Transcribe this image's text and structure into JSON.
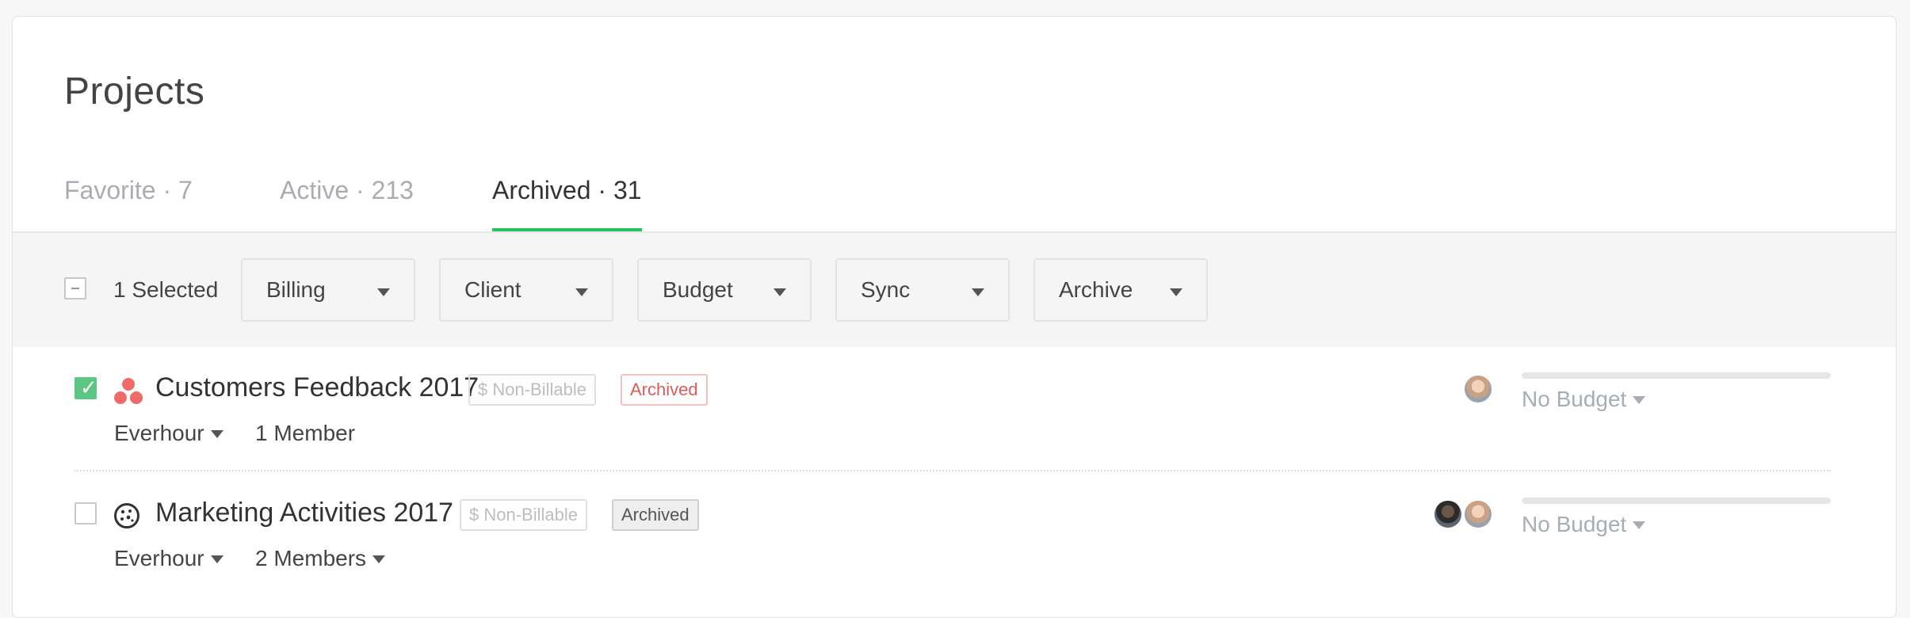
{
  "page": {
    "title": "Projects"
  },
  "tabs": [
    {
      "label": "Favorite · 7",
      "active": false
    },
    {
      "label": "Active · 213",
      "active": false
    },
    {
      "label": "Archived · 31",
      "active": true
    }
  ],
  "toolbar": {
    "selected_label": "1 Selected",
    "dropdowns": [
      "Billing",
      "Client",
      "Budget",
      "Sync",
      "Archive"
    ]
  },
  "projects": [
    {
      "name": "Customers Feedback 2017",
      "billing_badge": "$ Non-Billable",
      "status_badge": "Archived",
      "client": "Everhour",
      "members": "1 Member",
      "budget": "No Budget",
      "checked": true,
      "icon": "asana-icon"
    },
    {
      "name": "Marketing Activities 2017",
      "billing_badge": "$ Non-Billable",
      "status_badge": "Archived",
      "client": "Everhour",
      "members": "2 Members",
      "budget": "No Budget",
      "checked": false,
      "icon": "cookie-icon"
    }
  ],
  "colors": {
    "accent": "#22c55e",
    "checkbox_checked": "#5cc785",
    "archived_red": "#e05a5a",
    "asana": "#f06a6a"
  }
}
